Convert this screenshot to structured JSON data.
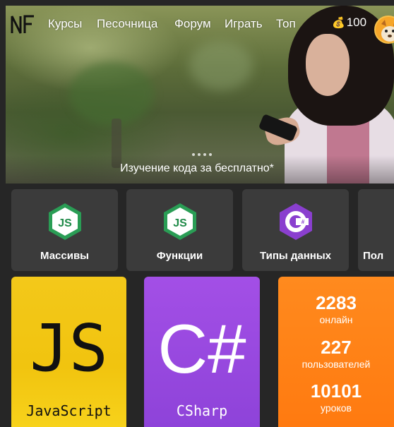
{
  "navbar": {
    "logo": "NF",
    "links": [
      "Курсы",
      "Песочница",
      "Форум",
      "Играть",
      "Топ"
    ],
    "coins": "100"
  },
  "hero": {
    "caption": "Изучение кода за бесплатно*",
    "slide_count": 4
  },
  "topics": [
    {
      "label": "Массивы",
      "icon": "js-hexagon-icon"
    },
    {
      "label": "Функции",
      "icon": "js-hexagon-icon"
    },
    {
      "label": "Типы данных",
      "icon": "csharp-hexagon-icon"
    },
    {
      "label": "Пол"
    }
  ],
  "courses": [
    {
      "big": "JS",
      "name": "JavaScript",
      "color": "#f1c40f"
    },
    {
      "big": "C#",
      "name": "CSharp",
      "color": "#9b4ae2"
    }
  ],
  "stats": [
    {
      "value": "2283",
      "label": "онлайн"
    },
    {
      "value": "227",
      "label": "пользователей"
    },
    {
      "value": "10101",
      "label": "уроков"
    }
  ],
  "colors": {
    "background": "#262626",
    "tile": "#3b3b3b",
    "stats": "#ff8219",
    "js_green": "#1f9a4a",
    "csharp_purple": "#8a3fcf"
  }
}
